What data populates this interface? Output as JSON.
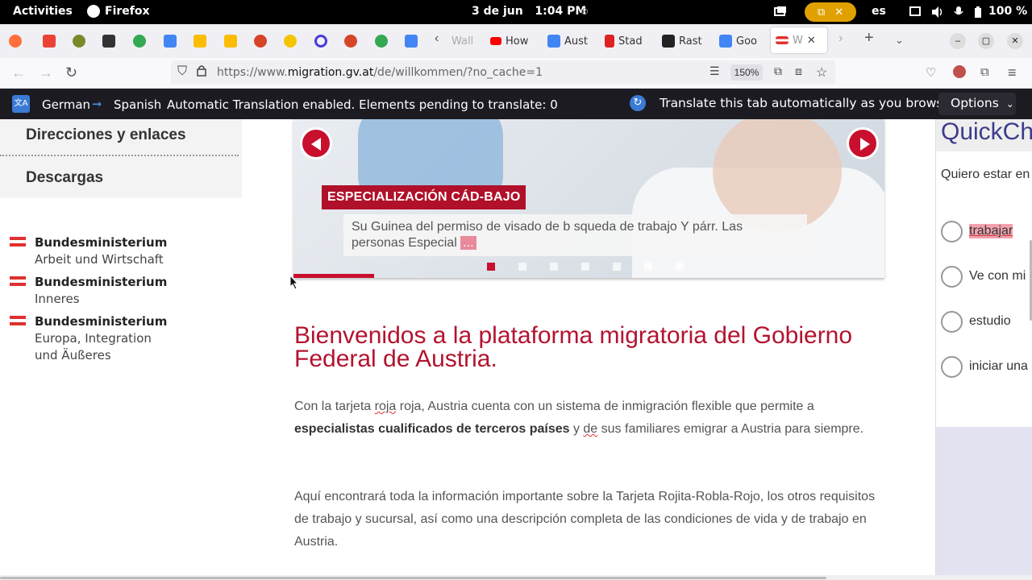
{
  "system": {
    "activities": "Activities",
    "app_name": "Firefox",
    "date": "3 de jun",
    "time": "1:04 PM",
    "language": "es",
    "battery": "100 %"
  },
  "tabs": [
    {
      "label": "Wall",
      "favicon": "#888888"
    },
    {
      "label": "How",
      "favicon": "#ff0000"
    },
    {
      "label": "Aust",
      "favicon": "#4285f4"
    },
    {
      "label": "Stad",
      "favicon": "#d22"
    },
    {
      "label": "Rast",
      "favicon": "#222"
    },
    {
      "label": "Goo",
      "favicon": "#4285f4"
    },
    {
      "label": "W",
      "favicon": "#e03030"
    }
  ],
  "nav": {
    "url_prefix": "https://www.",
    "url_domain": "migration.gv.at",
    "url_path": "/de/willkommen/?no_cache=1",
    "zoom": "150%"
  },
  "translation": {
    "source_lang": "German",
    "target_lang": "Spanish",
    "status": "Automatic Translation enabled. Elements pending to translate: 0",
    "auto_label": "Translate this tab automatically as you browse",
    "options_label": "Options"
  },
  "sidebar": {
    "items": [
      "Direcciones y enlaces",
      "Descargas"
    ]
  },
  "logos": [
    {
      "line1": "Bundesministerium",
      "line2": "Arbeit und Wirtschaft",
      "line3": ""
    },
    {
      "line1": "Bundesministerium",
      "line2": "Inneres",
      "line3": ""
    },
    {
      "line1": "Bundesministerium",
      "line2": "Europa, Integration",
      "line3": "und Äußeres"
    }
  ],
  "slider": {
    "badge": "ESPECIALIZACIÓN CÁD-BAJO",
    "text": "Su Guinea del permiso de visado de b squeda de trabajo Y párr. Las personas Especial",
    "text_tail": "...",
    "dot_count": 7,
    "active_dot": 0
  },
  "main": {
    "title": "Bienvenidos a la plataforma migratoria del Gobierno Federal de Austria.",
    "p1_a": "Con la tarjeta ",
    "p1_roja1": "roja",
    "p1_b": " roja, Austria cuenta con un sistema de inmigración flexible que permite a ",
    "p1_bold": "especialistas cualificados de terceros países",
    "p1_c": " y ",
    "p1_de": "de",
    "p1_d": " sus familiares emigrar a Austria para siempre.",
    "p2": "Aquí encontrará toda la información importante sobre la Tarjeta Rojita-Robla-Rojo, los otros requisitos de trabajo y sucursal, así como una descripción completa de las condiciones de vida y de trabajo en Austria."
  },
  "quick": {
    "title": "QuickCh",
    "subtitle": "Quiero estar en",
    "options": [
      "trabajar",
      "Ve con mi",
      "estudio",
      "iniciar una"
    ]
  }
}
